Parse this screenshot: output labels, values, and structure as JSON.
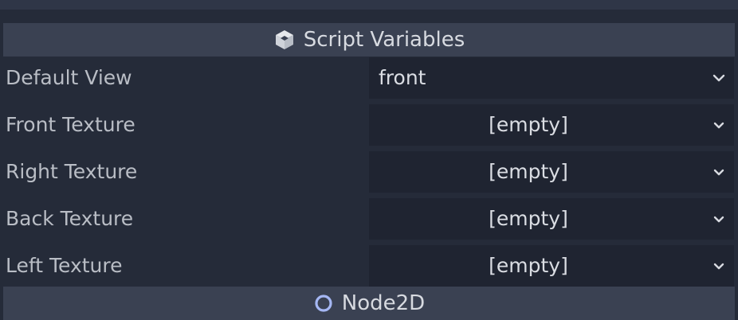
{
  "section_script": {
    "title": "Script Variables",
    "icon": "script-cube-icon"
  },
  "properties": [
    {
      "label": "Default View",
      "value": "front"
    },
    {
      "label": "Front Texture",
      "value": "[empty]"
    },
    {
      "label": "Right Texture",
      "value": "[empty]"
    },
    {
      "label": "Back Texture",
      "value": "[empty]"
    },
    {
      "label": "Left Texture",
      "value": "[empty]"
    }
  ],
  "section_node2d": {
    "title": "Node2D",
    "icon": "node2d-icon"
  },
  "colors": {
    "background": "#252b39",
    "header": "#3a4152",
    "field": "#1f2431",
    "node2d_accent": "#a5b7f3"
  }
}
